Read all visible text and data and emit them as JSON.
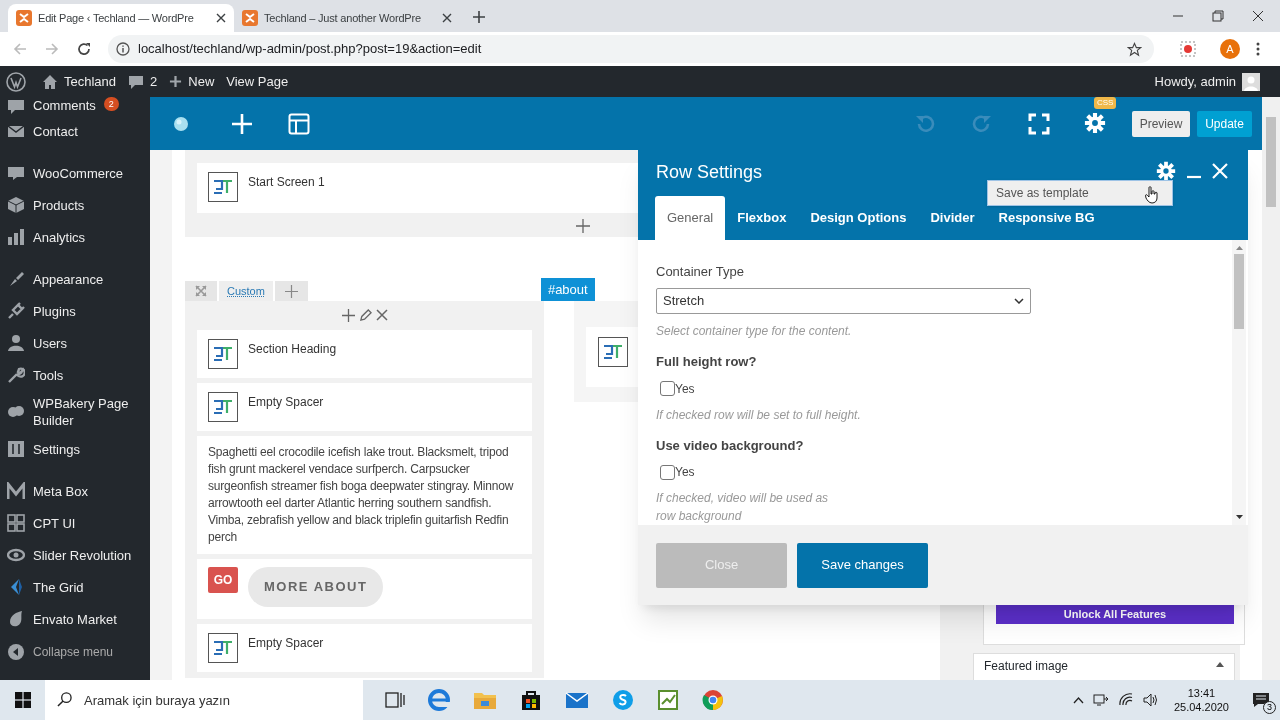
{
  "browser": {
    "tabs": [
      {
        "title": "Edit Page ‹ Techland — WordPre",
        "selected": true
      },
      {
        "title": "Techland – Just another WordPre",
        "selected": false
      }
    ],
    "address": "localhost/techland/wp-admin/post.php?post=19&action=edit",
    "profile_initial": "A"
  },
  "admin_bar": {
    "site": "Techland",
    "comments": "2",
    "new": "New",
    "view": "View Page",
    "greeting": "Howdy, admin"
  },
  "sidebar": {
    "groups": [
      [
        {
          "label": "Comments",
          "badge": "2"
        },
        {
          "label": "Contact"
        }
      ],
      [
        {
          "label": "WooCommerce"
        },
        {
          "label": "Products"
        },
        {
          "label": "Analytics"
        }
      ],
      [
        {
          "label": "Appearance"
        },
        {
          "label": "Plugins"
        },
        {
          "label": "Users"
        },
        {
          "label": "Tools"
        },
        {
          "label": "WPBakery Page Builder"
        },
        {
          "label": "Settings"
        }
      ],
      [
        {
          "label": "Meta Box"
        },
        {
          "label": "CPT UI"
        },
        {
          "label": "Slider Revolution"
        },
        {
          "label": "The Grid"
        },
        {
          "label": "Envato Market"
        }
      ]
    ],
    "collapse": "Collapse menu"
  },
  "builder_toolbar": {
    "undo": {
      "disabled": true
    },
    "redo": {
      "disabled": true
    },
    "css_badge": "CSS",
    "preview": "Preview",
    "update": "Update"
  },
  "canvas": {
    "row_1": {
      "elements": [
        {
          "title": "Start Screen 1"
        }
      ]
    },
    "row_2": {
      "tab": "Custom",
      "anchor": "#about",
      "column_1": [
        {
          "kind": "element",
          "title": "Section Heading"
        },
        {
          "kind": "element",
          "title": "Empty Spacer"
        },
        {
          "kind": "text",
          "text": "Spaghetti eel crocodile icefish lake trout. Blacksmelt, tripod fish grunt mackerel vendace surfperch. Carpsucker surgeonfish streamer fish boga deepwater stingray. Minnow arrowtooth eel darter Atlantic herring southern sandfish. Vimba, zebrafish yellow and black triplefin guitarfish Redfin perch"
        },
        {
          "kind": "buttons",
          "go": "GO",
          "more": "MORE ABOUT"
        },
        {
          "kind": "element",
          "title": "Empty Spacer"
        }
      ]
    }
  },
  "modal": {
    "title": "Row Settings",
    "tooltip": "Save as template",
    "tabs": [
      {
        "label": "General",
        "selected": true
      },
      {
        "label": "Flexbox",
        "selected": false
      },
      {
        "label": "Design Options",
        "selected": false
      },
      {
        "label": "Divider",
        "selected": false
      },
      {
        "label": "Responsive BG",
        "selected": false
      }
    ],
    "fields": [
      {
        "kind": "select",
        "label": "Container Type",
        "value": "Stretch",
        "hint": "Select container type for the content."
      },
      {
        "kind": "checkbox",
        "label": "Full height row?",
        "option": "Yes",
        "checked": false,
        "hint": "If checked row will be set to full height."
      },
      {
        "kind": "checkbox",
        "label": "Use video background?",
        "option": "Yes",
        "checked": false,
        "hint": "If checked, video will be used as row background"
      }
    ],
    "buttons": [
      {
        "label": "Close",
        "kind": "secondary"
      },
      {
        "label": "Save changes",
        "kind": "primary"
      }
    ]
  },
  "side_panel": {
    "unlock": "Unlock All Features",
    "featured": "Featured image"
  },
  "taskbar": {
    "search_placeholder": "Aramak için buraya yazın",
    "time": "13:41",
    "date": "25.04.2020",
    "notifications": "3"
  }
}
